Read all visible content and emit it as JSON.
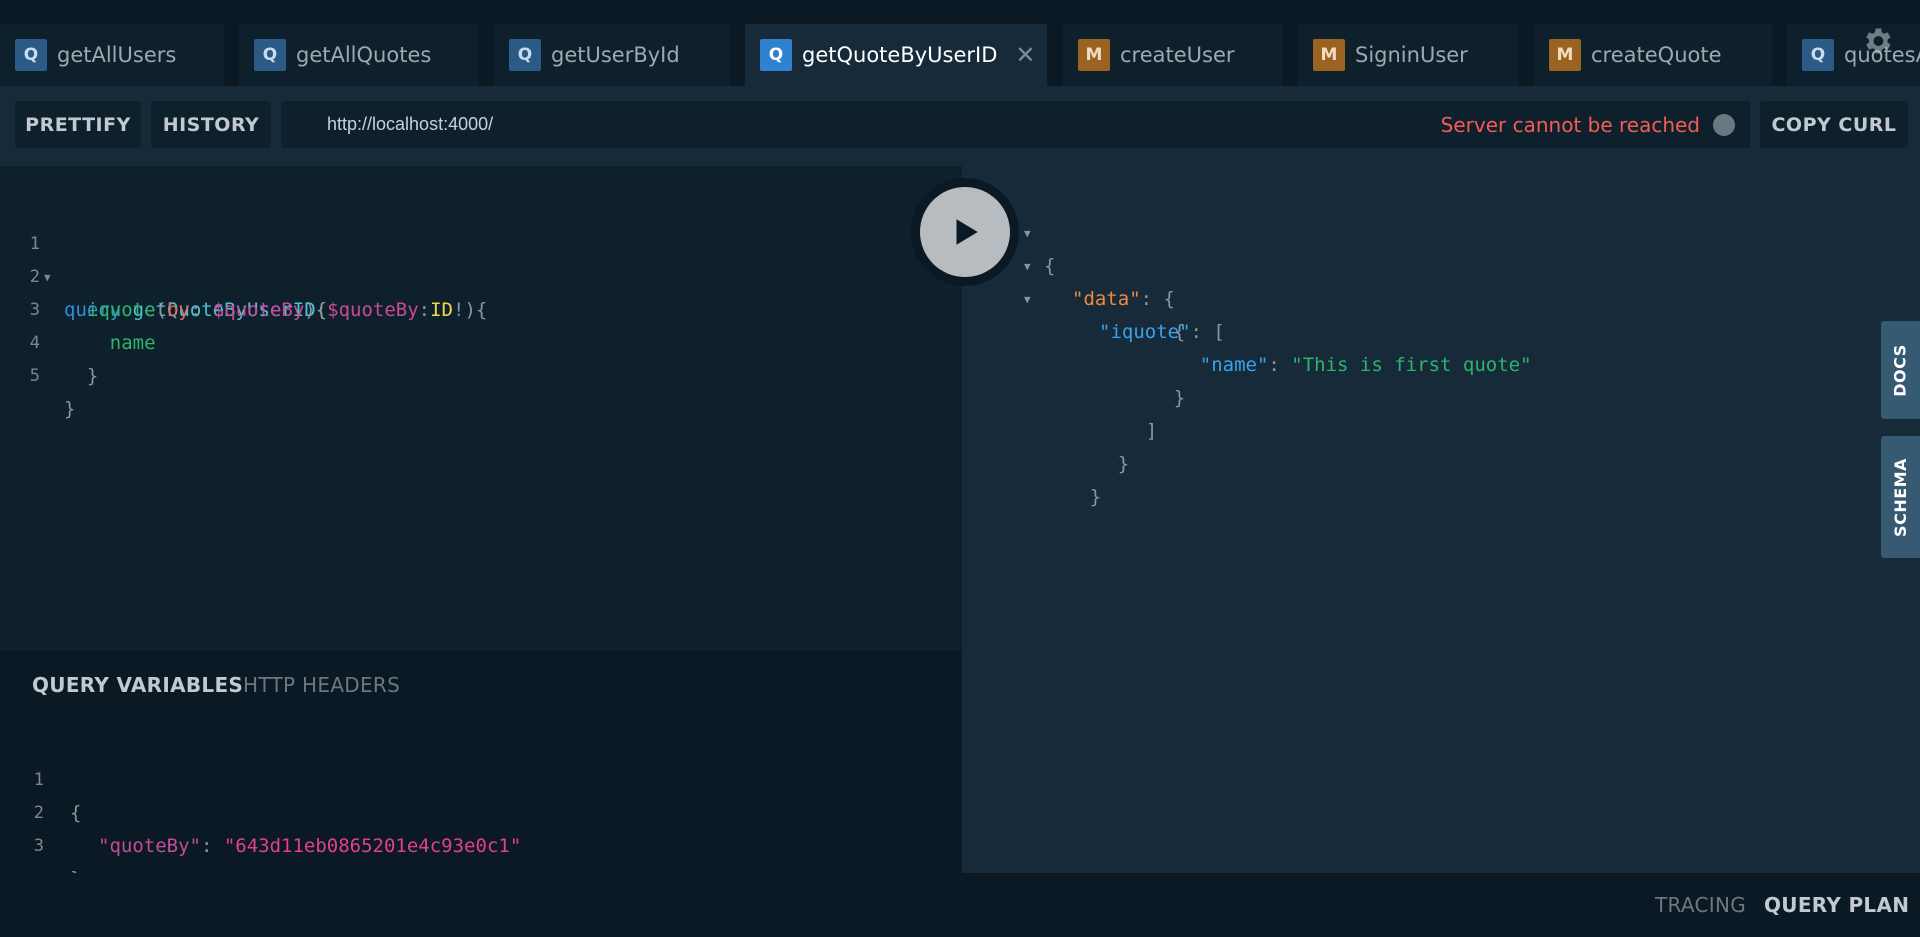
{
  "tabs": [
    {
      "badge": "Q",
      "label": "getAllUsers"
    },
    {
      "badge": "Q",
      "label": "getAllQuotes"
    },
    {
      "badge": "Q",
      "label": "getUserById"
    },
    {
      "badge": "Q",
      "label": "getQuoteByUserID",
      "close": "✕"
    },
    {
      "badge": "M",
      "label": "createUser"
    },
    {
      "badge": "M",
      "label": "SigninUser"
    },
    {
      "badge": "M",
      "label": "createQuote"
    },
    {
      "badge": "Q",
      "label": "quotesA"
    }
  ],
  "toolbar": {
    "prettify": "PRETTIFY",
    "history": "HISTORY",
    "url": "http://localhost:4000/",
    "server_status": "Server cannot be reached",
    "copy_curl": "COPY CURL"
  },
  "editor": {
    "line_numbers": [
      "1",
      "2",
      "3",
      "4",
      "5"
    ],
    "l1": {
      "kw": "query",
      "name": "getQuoteByUserID",
      "open": "(",
      "var": "$quoteBy",
      "colon": ":",
      "type": "ID",
      "close": "!){"
    },
    "l2": {
      "field": "iquote",
      "open": "(",
      "arg": "by",
      "colon": ": ",
      "var": "$quoteBy",
      "close": "){"
    },
    "l3": {
      "field": "name"
    },
    "l4": {
      "close": "}"
    },
    "l5": {
      "close": "}"
    }
  },
  "result": {
    "open_brace": "{",
    "data_key": "\"data\"",
    "data_open": ": {",
    "iquote_key": "\"iquote\"",
    "iquote_open": ": [",
    "obj_open": "{",
    "name_key": "\"name\"",
    "name_sep": ": ",
    "name_value": "\"This is first quote\"",
    "obj_close": "}",
    "arr_close": "]",
    "data_close": "}",
    "close_brace": "}"
  },
  "sidebar": {
    "docs": "DOCS",
    "schema": "SCHEMA"
  },
  "variables": {
    "tab_query_variables": "QUERY VARIABLES",
    "tab_http_headers": "HTTP HEADERS",
    "line_numbers": [
      "1",
      "2",
      "3"
    ],
    "open": "{",
    "key": "\"quoteBy\"",
    "sep": ": ",
    "value": "\"643d11eb0865201e4c93e0c1\"",
    "close": "}"
  },
  "footer": {
    "tracing": "TRACING",
    "query_plan": "QUERY PLAN"
  }
}
